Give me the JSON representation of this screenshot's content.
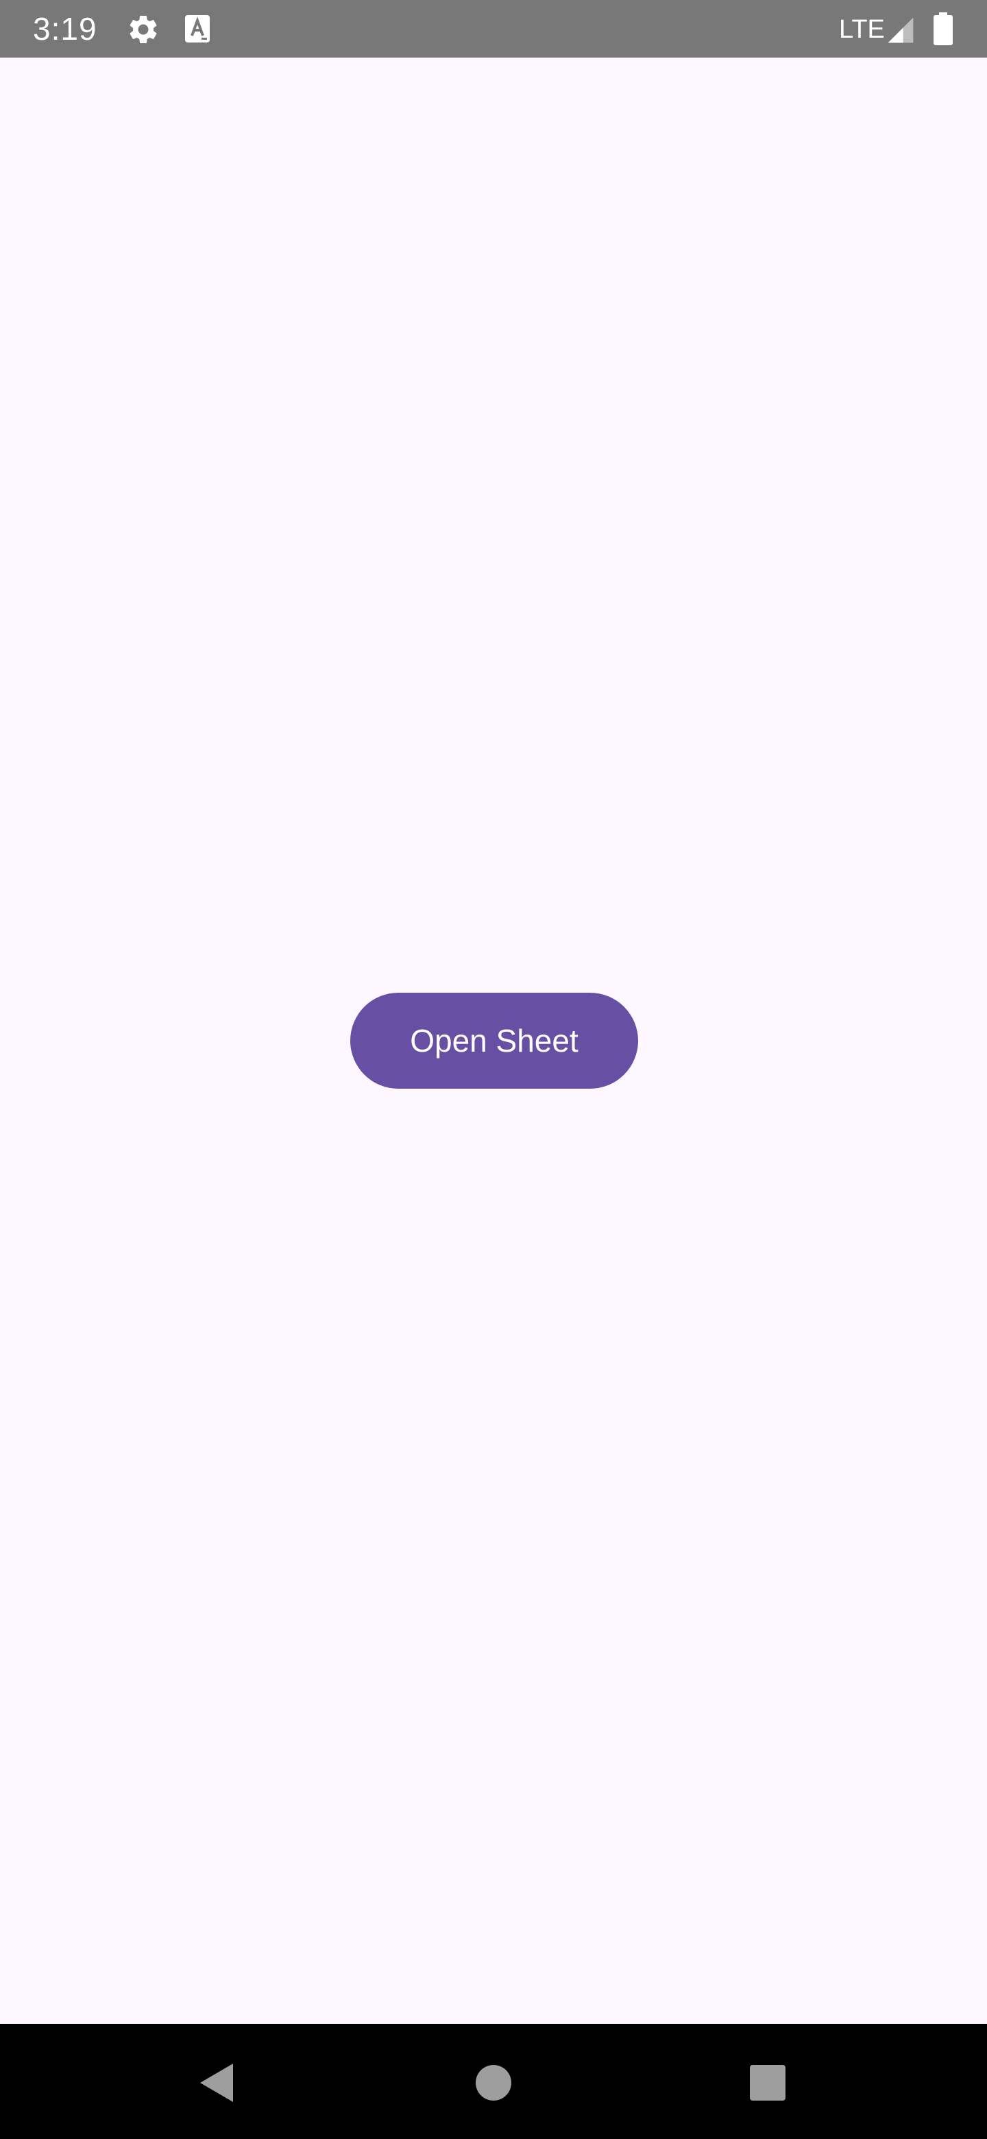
{
  "status_bar": {
    "time": "3:19",
    "network": "LTE",
    "icons": [
      "gear-icon",
      "text-a-icon",
      "signal-icon",
      "battery-icon"
    ],
    "background_color": "#787878"
  },
  "main": {
    "button_label": "Open Sheet",
    "button_color": "#6750a4",
    "background_color": "#fdf7ff"
  },
  "nav_bar": {
    "icons": [
      "back-icon",
      "home-icon",
      "recents-icon"
    ],
    "background_color": "#000000"
  }
}
